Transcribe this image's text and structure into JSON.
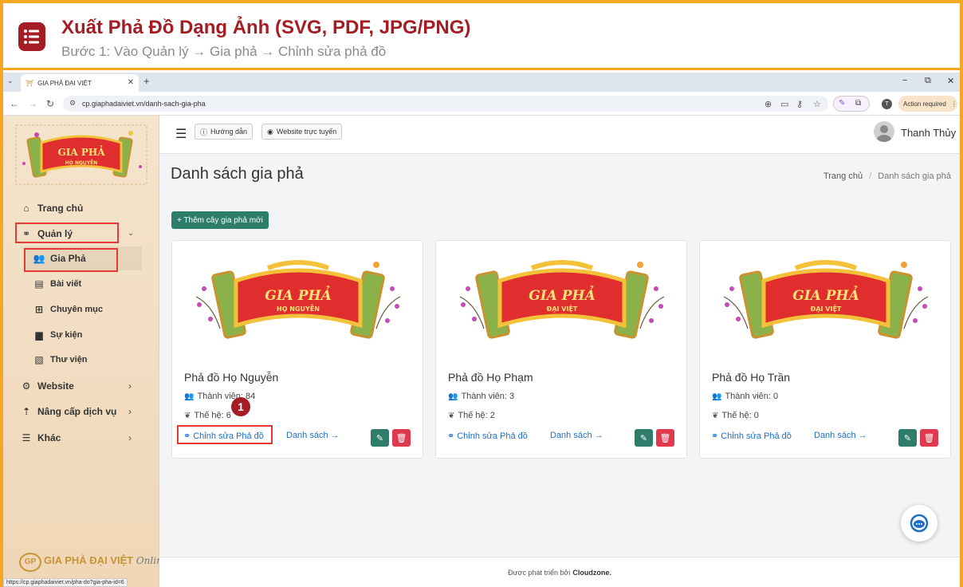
{
  "banner": {
    "title": "Xuất Phả Đồ Dạng Ảnh (SVG, PDF, JPG/PNG)",
    "subtitle": "Bước 1: Vào Quản lý → Gia phả → Chỉnh sửa phả đồ",
    "accent_color": "#a51d24",
    "border_color": "#f5a623"
  },
  "browser": {
    "tab_title": "GIA PHẢ ĐẠI VIỆT",
    "tab_close": "✕",
    "new_tab": "+",
    "url": "cp.giaphadaiviet.vn/danh-sach-gia-pha",
    "profile_initial": "T",
    "action_label": "Action required",
    "win_min": "−",
    "win_max": "⧉",
    "win_close": "✕",
    "status_url": "https://cp.giaphadaiviet.vn/pha-do?gia-pha-id=6"
  },
  "sidebar": {
    "items": [
      {
        "label": "Trang chủ",
        "icon": "home-icon"
      },
      {
        "label": "Quản lý",
        "icon": "sitemap-icon"
      },
      {
        "label": "Gia Phả",
        "icon": "users-icon"
      },
      {
        "label": "Bài viết",
        "icon": "newspaper-icon"
      },
      {
        "label": "Chuyên mục",
        "icon": "grid-icon"
      },
      {
        "label": "Sự kiện",
        "icon": "calendar-icon"
      },
      {
        "label": "Thư viện",
        "icon": "images-icon"
      },
      {
        "label": "Website",
        "icon": "gear-icon"
      },
      {
        "label": "Nâng cấp dịch vụ",
        "icon": "upgrade-icon"
      },
      {
        "label": "Khác",
        "icon": "list-icon"
      }
    ],
    "footer_logo": "GIA PHẢ ĐẠI VIỆT",
    "footer_logo_badge": "GP",
    "footer_logo_script": "Online"
  },
  "topbar": {
    "guide_label": "Hướng dẫn",
    "website_label": "Website trực tuyến",
    "user_name": "Thanh Thủy"
  },
  "page": {
    "title": "Danh sách gia phả",
    "breadcrumb_home": "Trang chủ",
    "breadcrumb_sep": "/",
    "breadcrumb_current": "Danh sách gia phả",
    "add_button": "+ Thêm cây gia phả mới"
  },
  "cards": [
    {
      "title": "Phả đồ Họ Nguyễn",
      "members": "Thành viên: 84",
      "generations": "Thế hệ: 6",
      "banner_line1": "GIA PHẢ",
      "banner_line2": "HỌ NGUYỄN",
      "edit_link": "Chỉnh sửa Phả đồ",
      "list_link": "Danh sách →"
    },
    {
      "title": "Phả đồ Họ Phạm",
      "members": "Thành viên: 3",
      "generations": "Thế hệ: 2",
      "banner_line1": "GIA PHẢ",
      "banner_line2": "ĐẠI VIỆT",
      "edit_link": "Chỉnh sửa Phả đồ",
      "list_link": "Danh sách →"
    },
    {
      "title": "Phả đồ Họ Trần",
      "members": "Thành viên: 0",
      "generations": "Thế hệ: 0",
      "banner_line1": "GIA PHẢ",
      "banner_line2": "ĐẠI VIỆT",
      "edit_link": "Chỉnh sửa Phả đồ",
      "list_link": "Danh sách →"
    }
  ],
  "step_badge": "1",
  "footer": {
    "text": "Được phát triển bởi",
    "brand": "Cloudzone."
  },
  "colors": {
    "primary_green": "#2e7d6b",
    "danger_red": "#e0384e",
    "link_blue": "#1f6fc5",
    "highlight_red": "#e53935"
  }
}
